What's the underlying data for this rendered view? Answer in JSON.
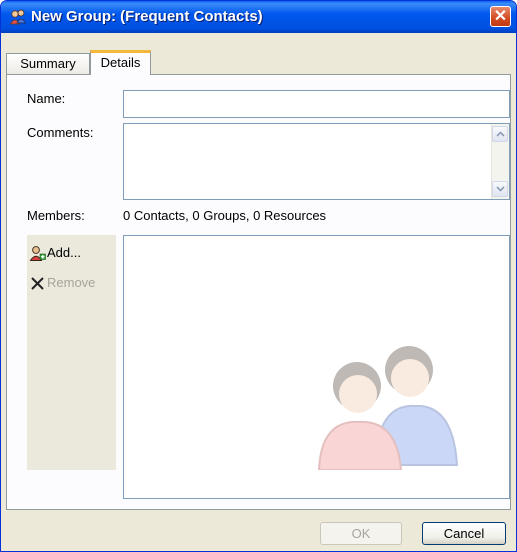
{
  "window": {
    "title": "New Group:  (Frequent Contacts)",
    "close_label": "✕"
  },
  "tabs": [
    {
      "label": "Summary",
      "selected": false
    },
    {
      "label": "Details",
      "selected": true
    }
  ],
  "form": {
    "name_label": "Name:",
    "name_value": "",
    "comments_label": "Comments:",
    "comments_value": "",
    "members_label": "Members:",
    "members_summary": "0 Contacts, 0 Groups, 0 Resources"
  },
  "actions": {
    "add_label": "Add...",
    "add_icon": "add-contact-icon",
    "remove_label": "Remove",
    "remove_icon": "x-icon",
    "remove_enabled": false
  },
  "members": [],
  "buttons": {
    "ok_label": "OK",
    "ok_enabled": false,
    "cancel_label": "Cancel"
  },
  "colors": {
    "titlebar": "#0058ee",
    "close": "#d24a20",
    "tab_highlight": "#f5b63c",
    "disabled_text": "#a6a59c"
  }
}
